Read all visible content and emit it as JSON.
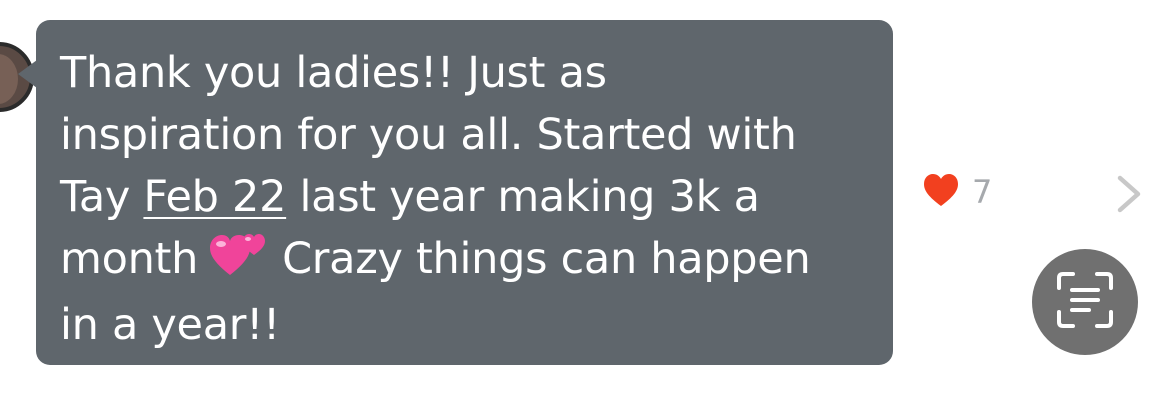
{
  "message": {
    "lines": [
      "Thank you ladies!! Just as",
      "inspiration for you all. Started with"
    ],
    "line3_before": "Tay ",
    "date_link": "Feb 22",
    "line3_after": " last year making 3k a",
    "line4_before": "month",
    "emoji_icon": "two-hearts-icon",
    "line4_after": "Crazy things can happen",
    "line5": "in a year!!"
  },
  "reaction": {
    "icon": "heart-icon",
    "count": "7",
    "color": "#f2401f"
  },
  "colors": {
    "bubble": "#5f666c",
    "scan_button": "#707070"
  },
  "icons": {
    "chevron": "chevron-right-icon",
    "scan": "text-scan-icon"
  }
}
